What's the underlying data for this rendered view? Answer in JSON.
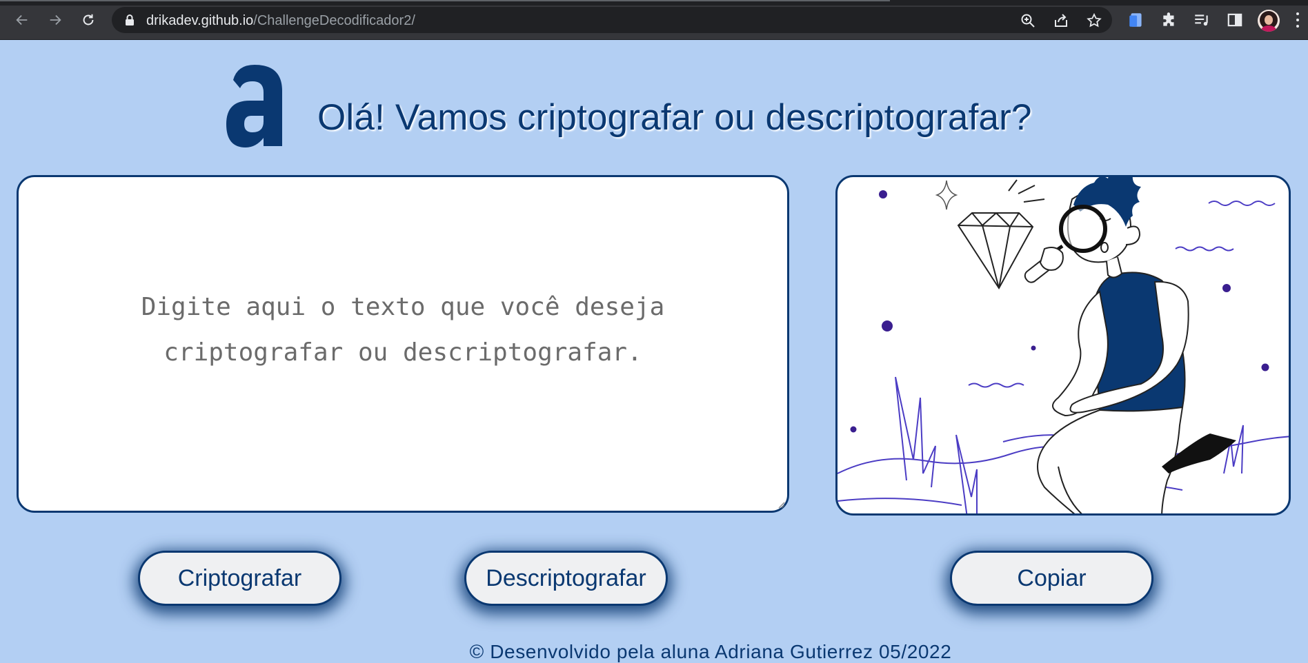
{
  "browser": {
    "url_host": "drikadev.github.io",
    "url_path": "/ChallengeDecodificador2/"
  },
  "header": {
    "logo_letter": "a",
    "title": "Olá! Vamos criptografar ou descriptografar?"
  },
  "input": {
    "placeholder": "Digite aqui o texto que você deseja criptografar ou descriptografar."
  },
  "buttons": {
    "encrypt_label": "Criptografar",
    "decrypt_label": "Descriptografar",
    "copy_label": "Copiar"
  },
  "footer": {
    "text": "© Desenvolvido pela aluna Adriana Gutierrez 05/2022"
  },
  "colors": {
    "page_background": "#b3cff3",
    "accent": "#0a3871",
    "card_background": "#ffffff",
    "button_background": "#eff0f2"
  }
}
